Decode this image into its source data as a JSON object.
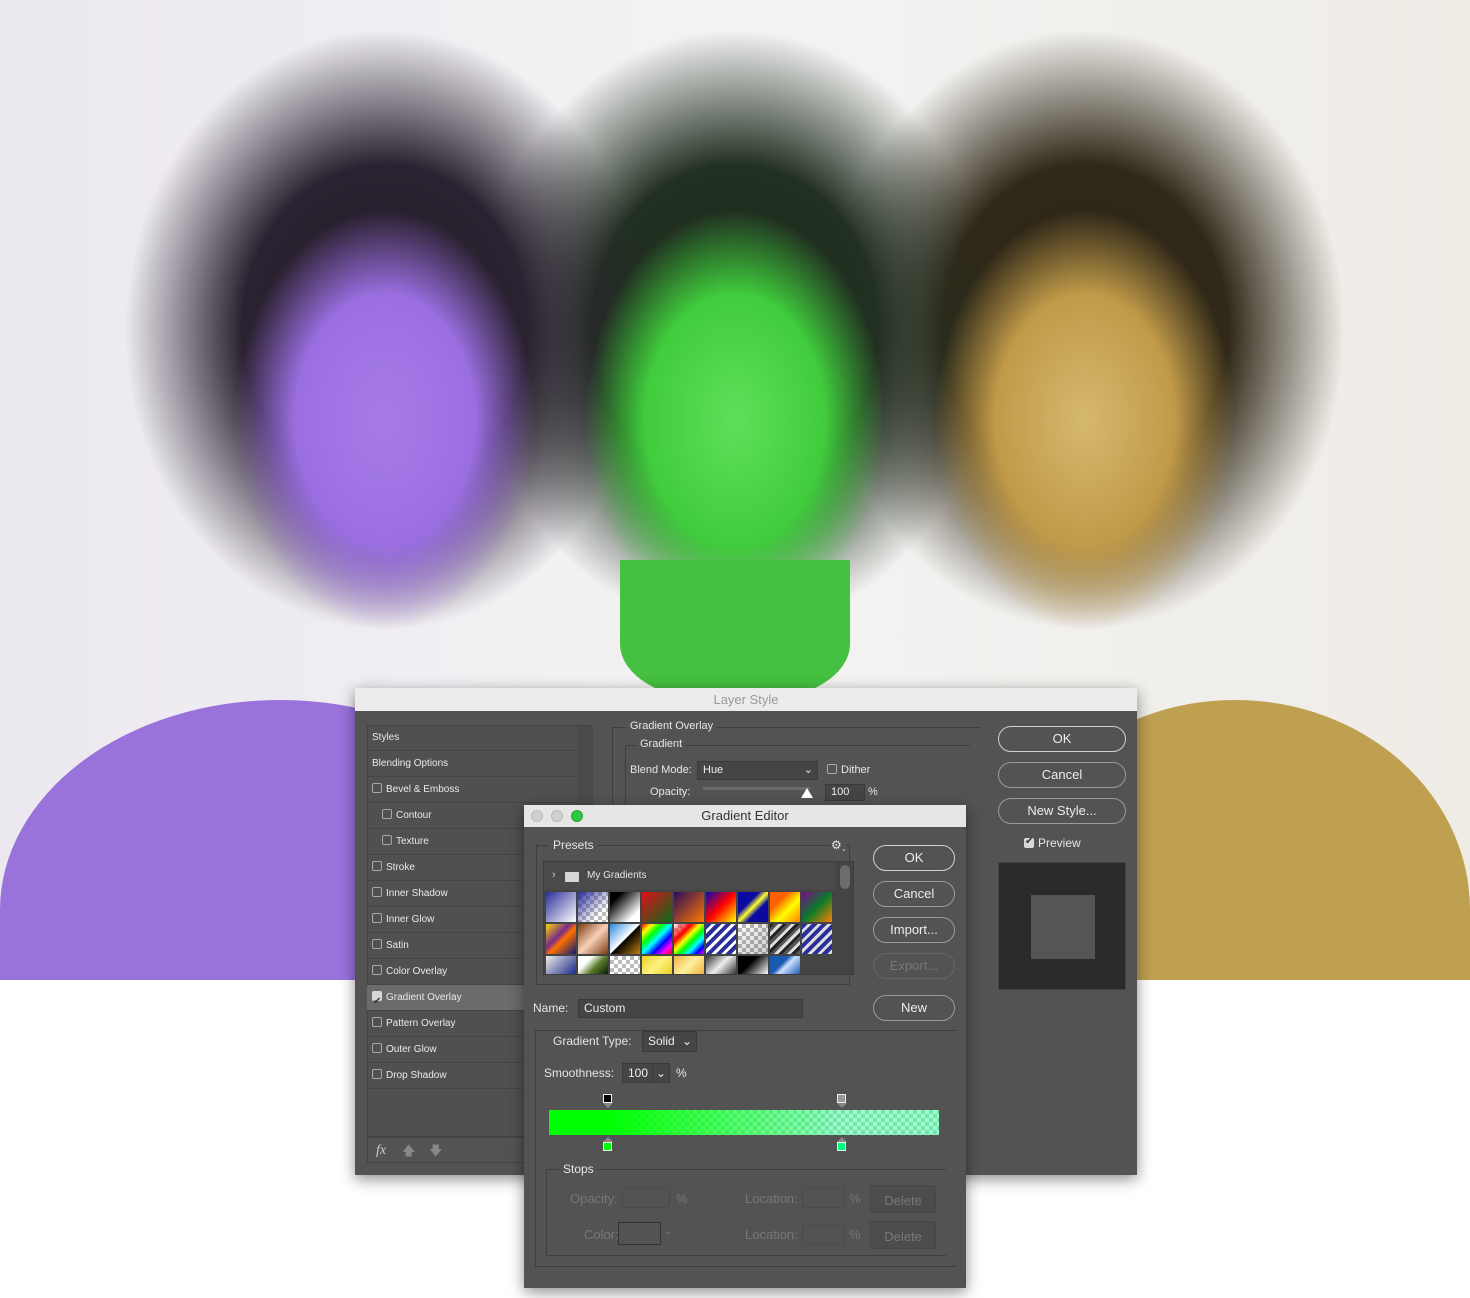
{
  "colors": {
    "accent_gradient_start": "#00ff00",
    "accent_gradient_end": "#00ff80",
    "dialog_bg": "#535353"
  },
  "layer_style": {
    "title": "Layer Style",
    "styles_list": [
      {
        "label": "Styles",
        "checkbox": false
      },
      {
        "label": "Blending Options",
        "checkbox": false
      },
      {
        "label": "Bevel & Emboss",
        "checkbox": true,
        "checked": false
      },
      {
        "label": "Contour",
        "checkbox": true,
        "checked": false,
        "indent": true
      },
      {
        "label": "Texture",
        "checkbox": true,
        "checked": false,
        "indent": true
      },
      {
        "label": "Stroke",
        "checkbox": true,
        "checked": false
      },
      {
        "label": "Inner Shadow",
        "checkbox": true,
        "checked": false
      },
      {
        "label": "Inner Glow",
        "checkbox": true,
        "checked": false
      },
      {
        "label": "Satin",
        "checkbox": true,
        "checked": false
      },
      {
        "label": "Color Overlay",
        "checkbox": true,
        "checked": false
      },
      {
        "label": "Gradient Overlay",
        "checkbox": true,
        "checked": true,
        "selected": true
      },
      {
        "label": "Pattern Overlay",
        "checkbox": true,
        "checked": false
      },
      {
        "label": "Outer Glow",
        "checkbox": true,
        "checked": false
      },
      {
        "label": "Drop Shadow",
        "checkbox": true,
        "checked": false
      }
    ],
    "footer_fx": "fx",
    "section_title": "Gradient Overlay",
    "subsection_title": "Gradient",
    "blend_mode_label": "Blend Mode:",
    "blend_mode_value": "Hue",
    "dither_label": "Dither",
    "dither_checked": false,
    "opacity_label": "Opacity:",
    "opacity_value": "100",
    "percent": "%",
    "ok": "OK",
    "cancel": "Cancel",
    "new_style": "New Style...",
    "preview_label": "Preview",
    "preview_checked": true
  },
  "gradient_editor": {
    "title": "Gradient Editor",
    "presets_label": "Presets",
    "folder_label": "My Gradients",
    "ok": "OK",
    "cancel": "Cancel",
    "import": "Import...",
    "export": "Export...",
    "new": "New",
    "name_label": "Name:",
    "name_value": "Custom",
    "gradient_type_label": "Gradient Type:",
    "gradient_type_value": "Solid",
    "smoothness_label": "Smoothness:",
    "smoothness_value": "100",
    "percent": "%",
    "color_stops": [
      {
        "location": 0.15,
        "color": "#00ff00"
      },
      {
        "location": 0.75,
        "color": "#00ff80"
      }
    ],
    "opacity_stops": [
      {
        "location": 0.15,
        "opacity": 1
      },
      {
        "location": 0.75,
        "opacity": 0.4
      }
    ],
    "stops_label": "Stops",
    "stops_opacity_label": "Opacity:",
    "stops_color_label": "Color:",
    "location_label": "Location:",
    "delete_label": "Delete"
  }
}
